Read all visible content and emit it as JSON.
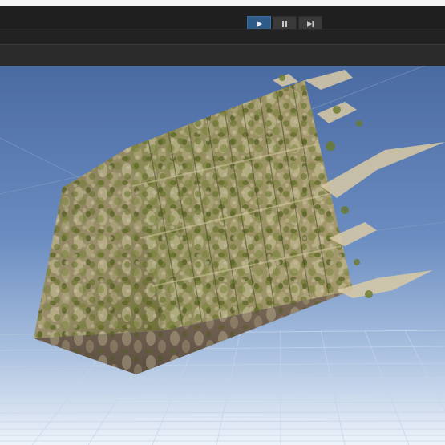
{
  "app": {
    "window": "game-view-editor"
  },
  "toolbar": {
    "play_controls": [
      {
        "name": "play",
        "icon": "play-icon",
        "active": true
      },
      {
        "name": "pause",
        "icon": "pause-icon",
        "active": false
      },
      {
        "name": "step",
        "icon": "step-icon",
        "active": false
      }
    ]
  },
  "colors": {
    "sky_top": "#4a6aa2",
    "sky_bottom": "#e8eff8",
    "accent": "#2e5a86",
    "moss": "#6b7a2a",
    "rock": "#8d7a66"
  },
  "scene": {
    "object": "mossy-rock-volume-cube",
    "has_grid": true
  }
}
